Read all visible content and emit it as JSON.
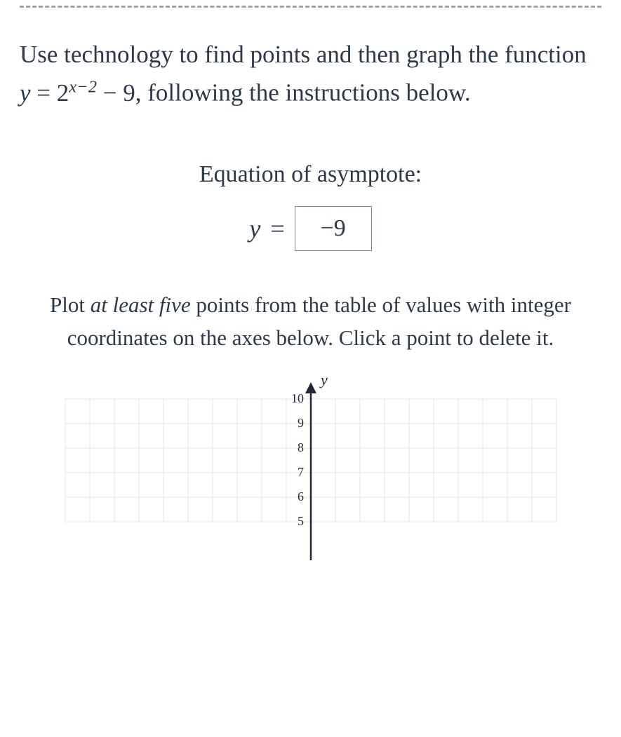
{
  "problem": {
    "line1_prefix": "Use technology to find points and then graph the function ",
    "eq_lhs_var": "y",
    "eq_equals": " = ",
    "eq_base": "2",
    "eq_exp_var": "x",
    "eq_exp_rest": "−2",
    "eq_tail": " − 9",
    "line1_suffix": ", following the instructions below."
  },
  "asymptote": {
    "label": "Equation of asymptote:",
    "y_var": "y",
    "equals": "=",
    "value": "−9"
  },
  "plot_instructions": {
    "pre": "Plot ",
    "em": "at least five",
    "post": " points from the table of values with integer coordinates on the axes below. Click a point to delete it."
  },
  "chart_data": {
    "type": "scatter",
    "title": "",
    "xlabel": "",
    "ylabel": "y",
    "xlim": [
      -10,
      10
    ],
    "ylim_visible": [
      5,
      10
    ],
    "y_ticks_visible": [
      5,
      6,
      7,
      8,
      9,
      10
    ],
    "series": []
  }
}
